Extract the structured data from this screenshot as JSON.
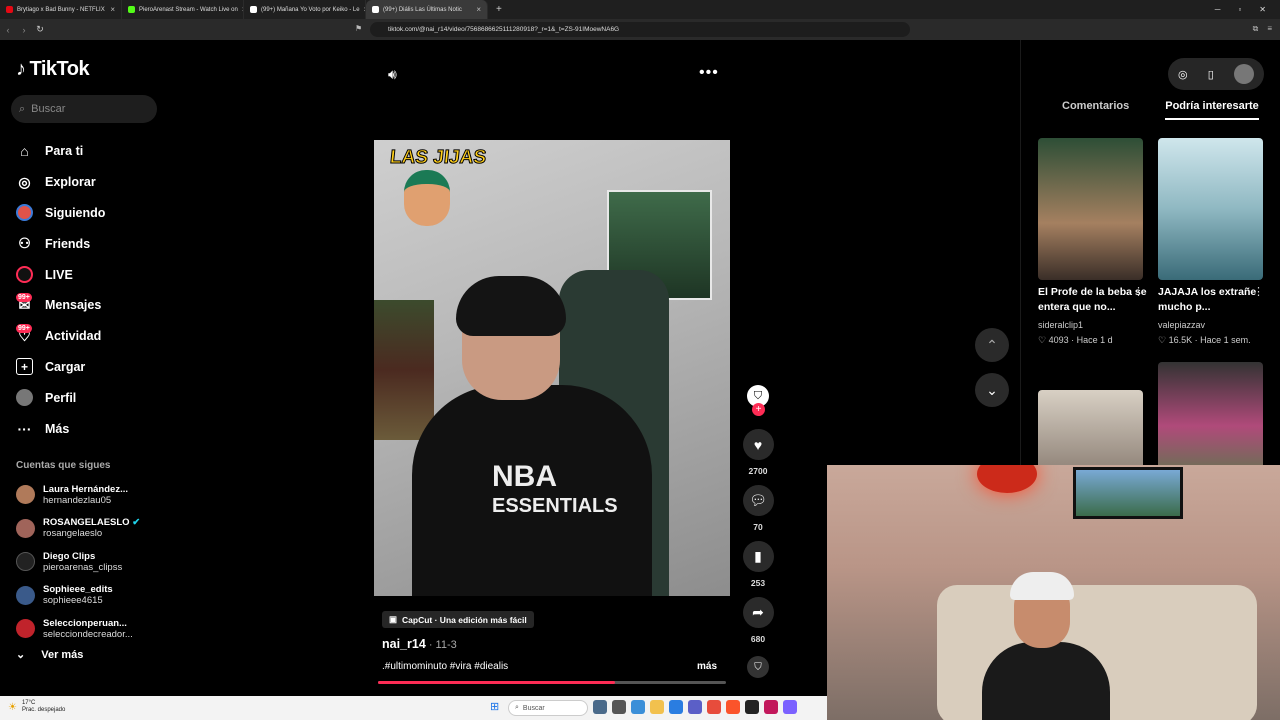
{
  "browser": {
    "tabs": [
      {
        "label": "Brytiago x Bad Bunny - NETFLIX",
        "color": "#e50914"
      },
      {
        "label": "PieroArenast Stream - Watch Live on",
        "color": "#53fc18"
      },
      {
        "label": "(99+) Mañana Yo Voto por Keiko - Le",
        "color": "#ffffff"
      },
      {
        "label": "(99+) Diális Las Últimas Notic",
        "color": "#ffffff",
        "active": true
      }
    ],
    "new_tab": "+",
    "url": "tiktok.com/@nai_r14/video/7568686625111280918?_r=1&_t=ZS-91IMoewNA6G"
  },
  "sidebar": {
    "logo": "TikTok",
    "search_placeholder": "Buscar",
    "nav": [
      {
        "label": "Para ti",
        "icon": "home-icon"
      },
      {
        "label": "Explorar",
        "icon": "compass-icon"
      },
      {
        "label": "Siguiendo",
        "icon": "following-icon"
      },
      {
        "label": "Friends",
        "icon": "friends-icon"
      },
      {
        "label": "LIVE",
        "icon": "live-icon"
      },
      {
        "label": "Mensajes",
        "icon": "messages-icon",
        "badge": "99+"
      },
      {
        "label": "Actividad",
        "icon": "activity-icon",
        "badge": "99+"
      },
      {
        "label": "Cargar",
        "icon": "upload-icon"
      },
      {
        "label": "Perfil",
        "icon": "profile-icon"
      },
      {
        "label": "Más",
        "icon": "more-icon"
      }
    ],
    "following_header": "Cuentas que sigues",
    "following": [
      {
        "name": "Laura Hernández...",
        "handle": "hernandezlau05",
        "color": "#b07a5a"
      },
      {
        "name": "ROSANGELAESLO",
        "handle": "rosangelaeslo",
        "color": "#a0645a",
        "verified": true
      },
      {
        "name": "Diego Clips",
        "handle": "pieroarenas_clipss",
        "color": "#222222"
      },
      {
        "name": "Sophieee_edits",
        "handle": "sophieee4615",
        "color": "#3a5a8a"
      },
      {
        "name": "Seleccionperuan...",
        "handle": "selecciondecreador...",
        "color": "#c0232b"
      }
    ],
    "see_more": "Ver más"
  },
  "video": {
    "overlay_title": "LAS JIJAS",
    "shirt_line1": "NBA",
    "shirt_line2": "ESSENTIALS",
    "capcut_label": "CapCut · Una edición más fácil",
    "author": "nai_r14",
    "date": " · 11-3",
    "caption": ".#ultimominuto #vira #diealis",
    "more": "más",
    "progress": 0.68
  },
  "actions": {
    "likes": "2700",
    "comments": "70",
    "saves": "253",
    "shares": "680"
  },
  "right_panel": {
    "tabs": [
      "Comentarios",
      "Podría interesarte"
    ],
    "videos": [
      {
        "title": "El Profe de la beba se entera que no...",
        "user": "sideralclip1",
        "likes": "4093",
        "age": "Hace 1 d"
      },
      {
        "title": "JAJAJA los extrañe mucho p...",
        "user": "valepiazzav",
        "likes": "16.5K",
        "age": "Hace 1 sem."
      }
    ]
  },
  "taskbar": {
    "temp": "17°C",
    "weather": "Prac. despejado",
    "search": "Buscar"
  }
}
